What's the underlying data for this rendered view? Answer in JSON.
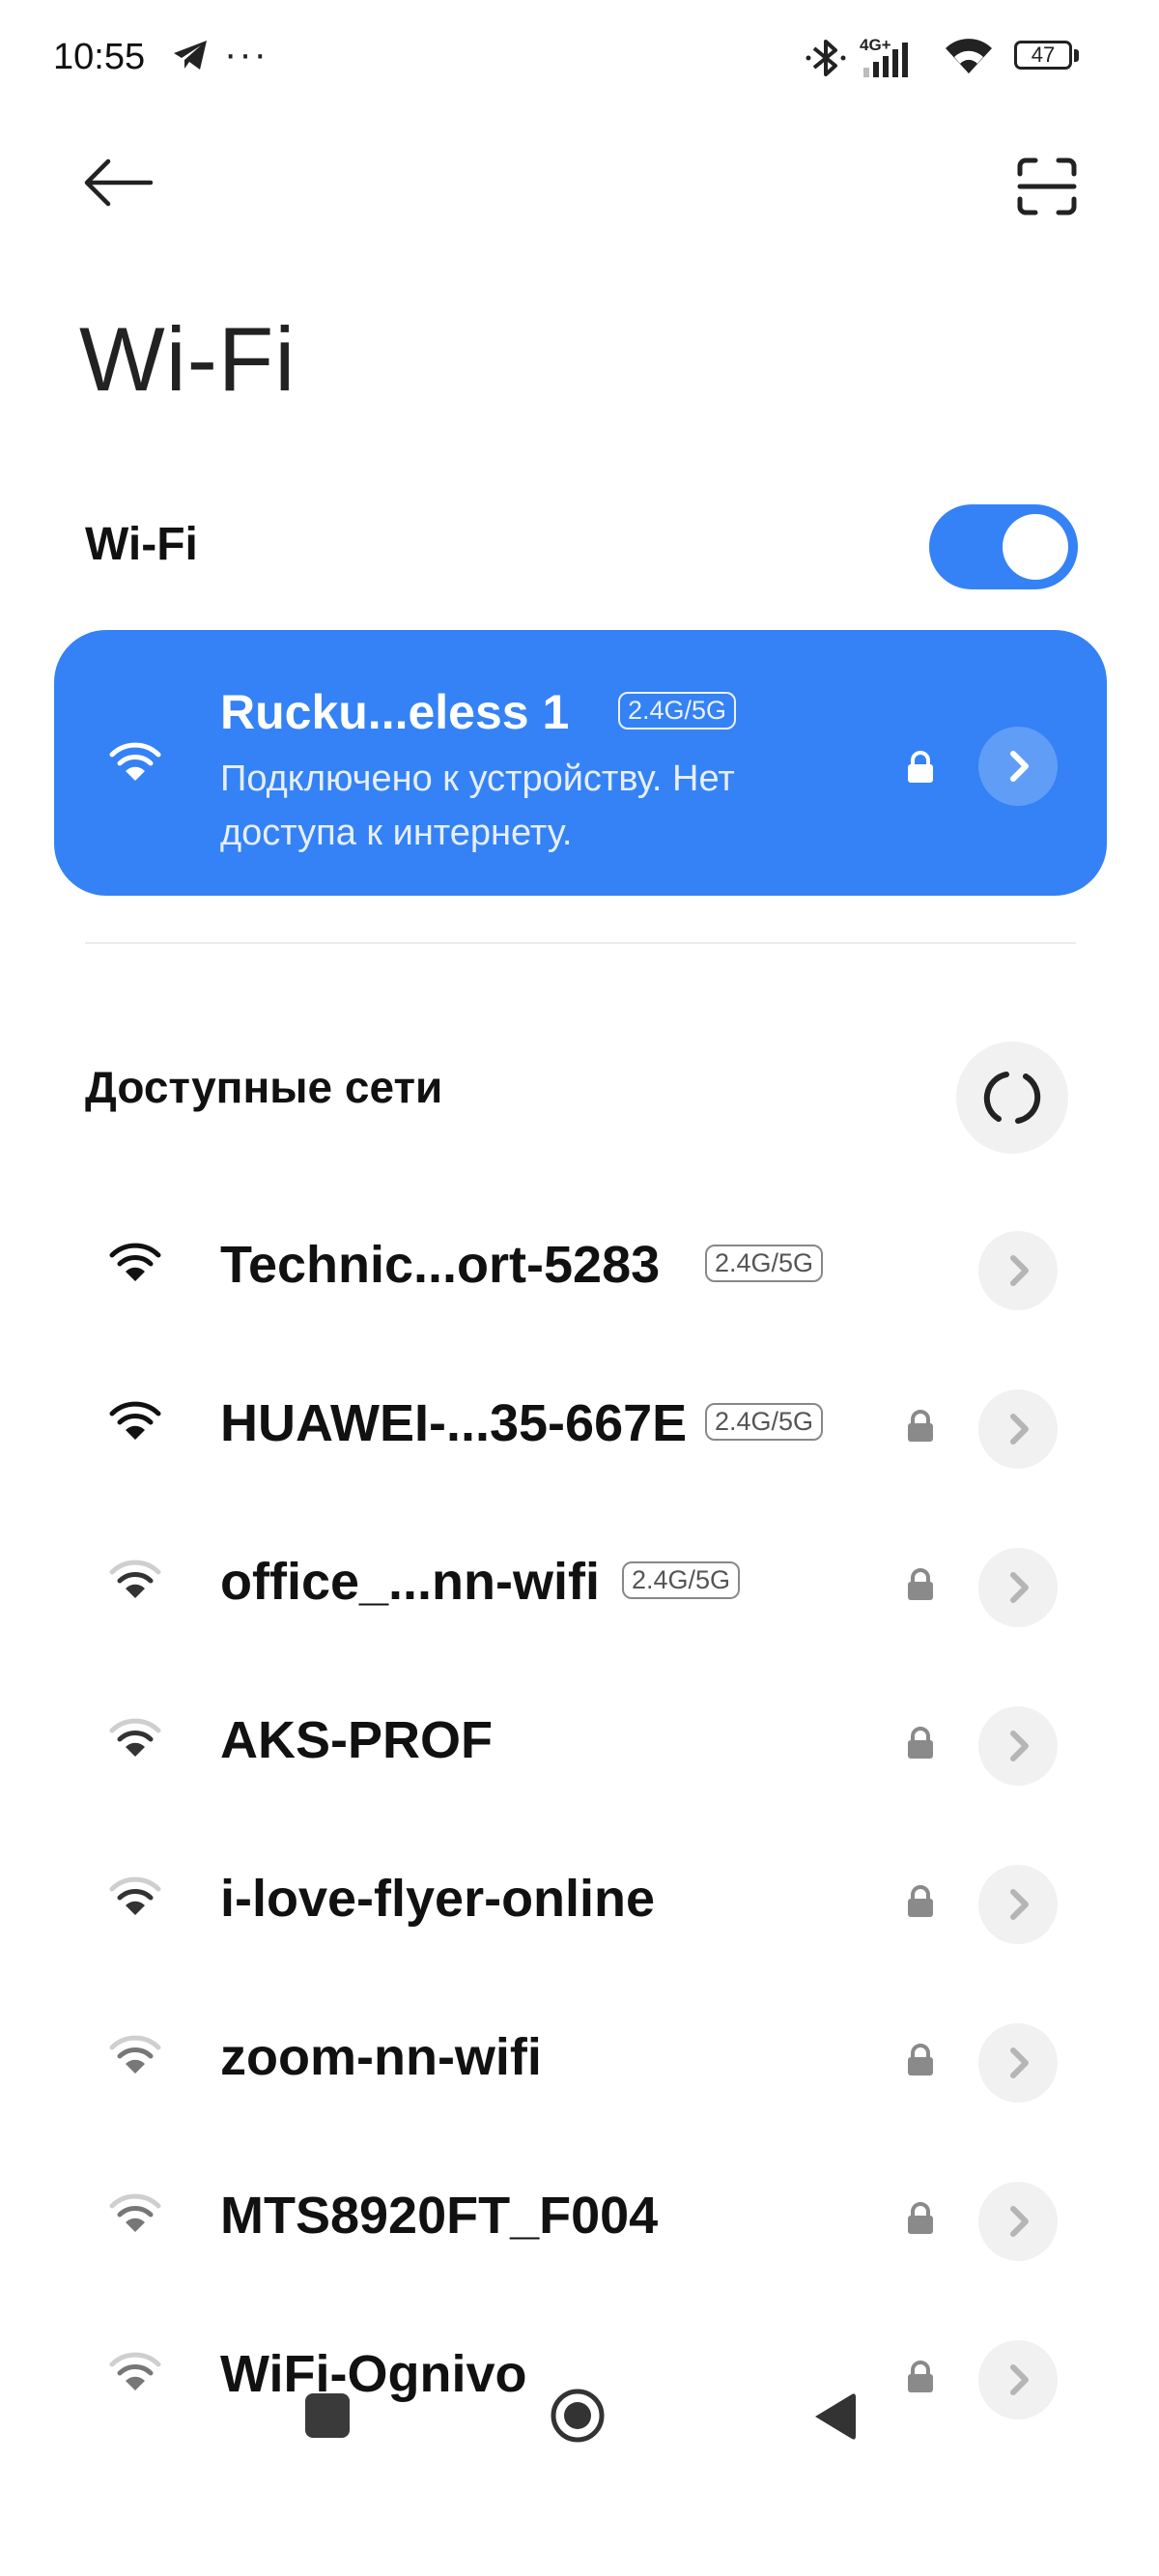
{
  "status_bar": {
    "time": "10:55",
    "overflow": "···",
    "network_type": "4G+",
    "battery": "47",
    "icons": [
      "telegram-icon",
      "bluetooth-icon",
      "cellular-signal-icon",
      "wifi-icon",
      "battery-icon"
    ]
  },
  "header": {
    "back_icon": "arrow-left-icon",
    "scan_icon": "qr-scan-icon",
    "title": "Wi-Fi"
  },
  "wifi_toggle": {
    "label": "Wi-Fi",
    "state": "on"
  },
  "connected": {
    "ssid": "Rucku...eless 1",
    "band": "2.4G/5G",
    "status": "Подключено к устройству. Нет доступа к интернету.",
    "secured": true
  },
  "available": {
    "title": "Доступные сети",
    "refresh_icon": "refresh-icon",
    "networks": [
      {
        "ssid": "Technic...ort-5283",
        "band": "2.4G/5G",
        "secured": false
      },
      {
        "ssid": "HUAWEI-...35-667E",
        "band": "2.4G/5G",
        "secured": true
      },
      {
        "ssid": "office_...nn-wifi",
        "band": "2.4G/5G",
        "secured": true
      },
      {
        "ssid": "AKS-PROF",
        "band": "",
        "secured": true
      },
      {
        "ssid": "i-love-flyer-online",
        "band": "",
        "secured": true
      },
      {
        "ssid": "zoom-nn-wifi",
        "band": "",
        "secured": true
      },
      {
        "ssid": "MTS8920FT_F004",
        "band": "",
        "secured": true
      },
      {
        "ssid": "WiFi-Ognivo",
        "band": "",
        "secured": true
      }
    ]
  },
  "nav_bar": {
    "icons": [
      "recents-icon",
      "home-icon",
      "back-icon"
    ]
  },
  "colors": {
    "accent": "#3482f5",
    "row_button_bg": "#f1f1f1",
    "text": "#111111"
  }
}
